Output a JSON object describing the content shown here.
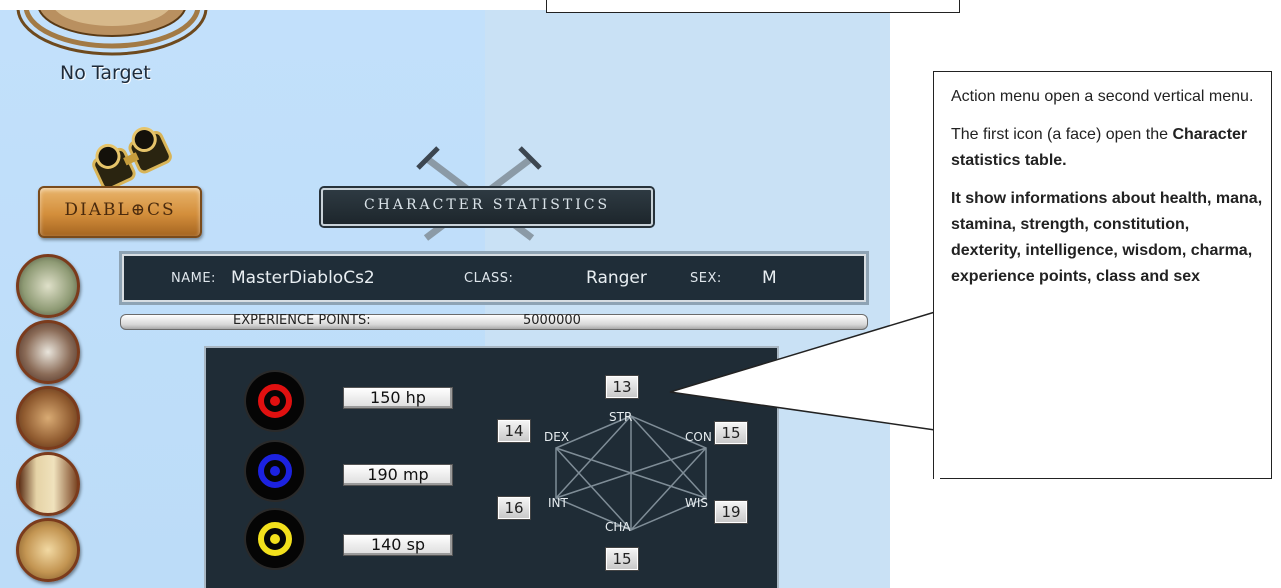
{
  "hud": {
    "target_text": "No Target",
    "logo_text": "DIABL⊕CS"
  },
  "panel_title": "CHARACTER STATISTICS",
  "character": {
    "name_label": "NAME:",
    "name": "MasterDiabloCs2",
    "class_label": "CLASS:",
    "class": "Ranger",
    "sex_label": "SEX:",
    "sex": "M",
    "exp_label": "EXPERIENCE POINTS:",
    "exp": "5000000"
  },
  "vitals": [
    {
      "name": "health",
      "value": "150 hp",
      "color": "#e01010",
      "icon": "health-orb-icon"
    },
    {
      "name": "mana",
      "value": "190 mp",
      "color": "#1c22e0",
      "icon": "mana-orb-icon"
    },
    {
      "name": "stamina",
      "value": "140 sp",
      "color": "#f2e01c",
      "icon": "stamina-orb-icon"
    }
  ],
  "attributes": {
    "str": {
      "label": "STR",
      "value": "13"
    },
    "con": {
      "label": "CON",
      "value": "15"
    },
    "wis": {
      "label": "WIS",
      "value": "19"
    },
    "cha": {
      "label": "CHA",
      "value": "15"
    },
    "int": {
      "label": "INT",
      "value": "16"
    },
    "dex": {
      "label": "DEX",
      "value": "14"
    }
  },
  "action_menu_icons": [
    "face-icon",
    "dragon-icon",
    "bag-icon",
    "scroll-icon",
    "compass-icon"
  ],
  "callout": {
    "p1": "Action menu open a second vertical menu.",
    "p2_prefix": "The first icon (a face) open the ",
    "p2_bold": "Character statistics table.",
    "p3": "It show informations about health, mana, stamina, strength, constitution, dexterity, intelligence, wisdom, charma, experience points, class and sex"
  }
}
